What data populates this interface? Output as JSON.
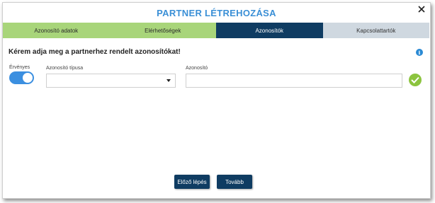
{
  "dialog": {
    "title": "PARTNER LÉTREHOZÁSA"
  },
  "tabs": [
    {
      "label": "Azonosító adatok",
      "state": "done"
    },
    {
      "label": "Elérhetőségek",
      "state": "done"
    },
    {
      "label": "Azonosítók",
      "state": "active"
    },
    {
      "label": "Kapcsolattartók",
      "state": "todo"
    }
  ],
  "form": {
    "heading": "Kérem adja meg a partnerhez rendelt azonosítókat!",
    "valid_label": "Érvényes",
    "valid_on": true,
    "type_label": "Azonosító típusa",
    "type_value": "",
    "id_label": "Azonosító",
    "id_value": ""
  },
  "buttons": {
    "prev": "Előző lépés",
    "next": "Tovább"
  },
  "colors": {
    "title": "#3a8fd6",
    "tab_done": "#a8d57a",
    "tab_active": "#0f3c62",
    "tab_todo": "#cfd8e0",
    "toggle": "#3b8fe0",
    "check": "#8cc43f",
    "button": "#0f3c62"
  },
  "icons": {
    "close": "close-icon",
    "info": "info-icon",
    "confirm": "check-icon",
    "dropdown": "chevron-down-icon"
  }
}
